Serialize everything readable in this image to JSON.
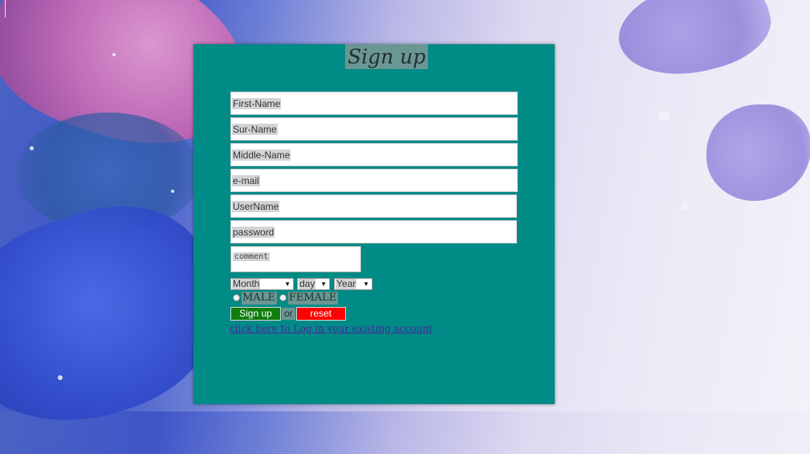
{
  "title": "Sign up",
  "fields": [
    {
      "placeholder": "First-Name"
    },
    {
      "placeholder": "Sur-Name"
    },
    {
      "placeholder": "Middle-Name"
    },
    {
      "placeholder": "e-mail"
    },
    {
      "placeholder": "UserName"
    },
    {
      "placeholder": "password"
    }
  ],
  "comment_placeholder": "comment",
  "selects": {
    "month": "Month",
    "day": "day",
    "year": "Year"
  },
  "gender": {
    "male": "MALE",
    "female": "FEMALE"
  },
  "buttons": {
    "signup": "Sign up",
    "or": "or",
    "reset": "reset"
  },
  "login_link": "click here to Log in your existing account",
  "colors": {
    "panel": "#008b87",
    "signup_button": "#0e7d0e",
    "reset_button": "#ff0000",
    "link": "#4a24a0"
  }
}
